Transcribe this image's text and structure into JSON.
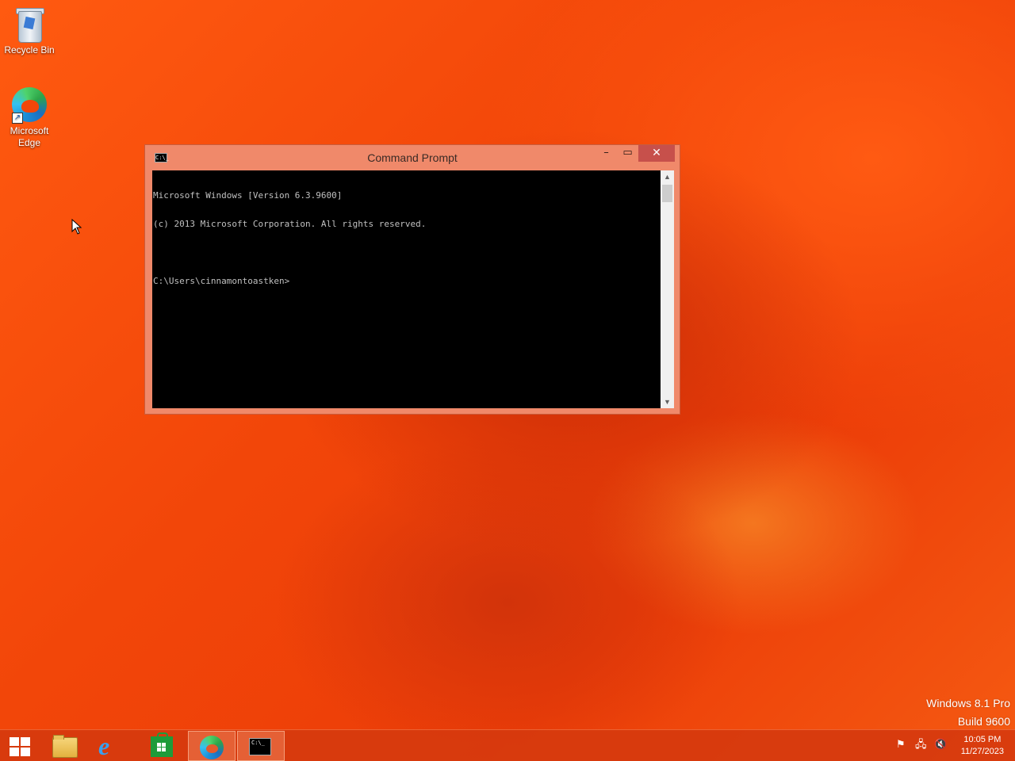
{
  "desktop": {
    "icons": [
      {
        "label": "Recycle Bin",
        "icon": "recycle-bin-icon"
      },
      {
        "label": "Microsoft Edge",
        "icon": "edge-icon"
      }
    ]
  },
  "cmd": {
    "title": "Command Prompt",
    "title_icon_text": "C:\\_",
    "buttons": {
      "minimize": "–",
      "maximize": "▭",
      "close": "✕"
    },
    "lines": [
      "Microsoft Windows [Version 6.3.9600]",
      "(c) 2013 Microsoft Corporation. All rights reserved.",
      "",
      "C:\\Users\\cinnamontoastken>"
    ],
    "scroll_up": "▲",
    "scroll_down": "▼"
  },
  "watermark": {
    "line1": "Windows 8.1 Pro",
    "line2": "Build 9600"
  },
  "taskbar": {
    "buttons": [
      {
        "name": "start-button",
        "icon": "windows-logo-icon"
      },
      {
        "name": "file-explorer-button",
        "icon": "folder-icon"
      },
      {
        "name": "internet-explorer-button",
        "icon": "ie-icon",
        "glyph": "e"
      },
      {
        "name": "store-button",
        "icon": "store-icon"
      },
      {
        "name": "edge-button",
        "icon": "edge-icon"
      },
      {
        "name": "command-prompt-button",
        "icon": "cmd-icon",
        "glyph": "C:\\_"
      }
    ],
    "tray": {
      "flag_icon": "⚑",
      "network_icon": "🖧",
      "volume_icon": "🔇"
    },
    "clock": {
      "time": "10:05 PM",
      "date": "11/27/2023"
    }
  },
  "colors": {
    "accent": "#f0896a",
    "close_button": "#c7504b",
    "console_bg": "#000000",
    "console_text": "#c0c0c0",
    "wallpaper": "#f24609"
  }
}
